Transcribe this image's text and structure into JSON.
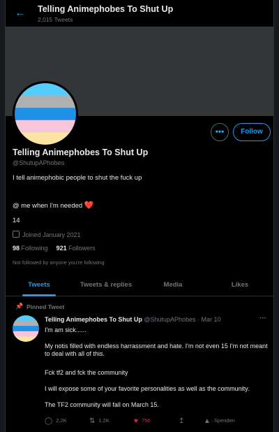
{
  "header": {
    "back_icon": "arrow-left-icon",
    "title": "Telling Animephobes To Shut Up",
    "tweet_count": "2,015 Tweets"
  },
  "profile": {
    "avatar_stripes": [
      "#55cdfc",
      "#b0b0b0",
      "#1e90e6",
      "#f7c6d9",
      "#fbe3a0"
    ],
    "more_label": "•••",
    "follow_label": "Follow",
    "name": "Telling Animephobes To Shut Up",
    "handle": "@ShutupAPhobes",
    "bio_line1": "I tell animephobic people to shut the fuck up",
    "bio_line2": "@ me when I'm needed",
    "bio_heart": "❤️",
    "bio_line3": "14",
    "joined": "Joined January 2021",
    "following_count": "98",
    "following_label": "Following",
    "followers_count": "921",
    "followers_label": "Followers",
    "not_followed": "Not followed by anyone you're following"
  },
  "tabs": [
    {
      "label": "Tweets",
      "active": true
    },
    {
      "label": "Tweets & replies",
      "active": false
    },
    {
      "label": "Media",
      "active": false
    },
    {
      "label": "Likes",
      "active": false
    }
  ],
  "tweet": {
    "pinned_label": "Pinned Tweet",
    "author_name": "Telling Animephobes To Shut Up",
    "author_handle": "@ShutupAPhobes",
    "date": "· Mar 10",
    "body": [
      "I'm am sick......",
      "My notis filled with endless harrassment and hate. I'm not even 15 I'm not meant to deal with all of this.",
      "Fck tf2 and fck the community",
      "I will expose some of your favorite personalities as well as the community.",
      "The TF2 community will fall on March 15."
    ],
    "actions": {
      "replies": "2.2K",
      "retweets": "1.2K",
      "likes": "756",
      "tip": "Spenden"
    }
  }
}
